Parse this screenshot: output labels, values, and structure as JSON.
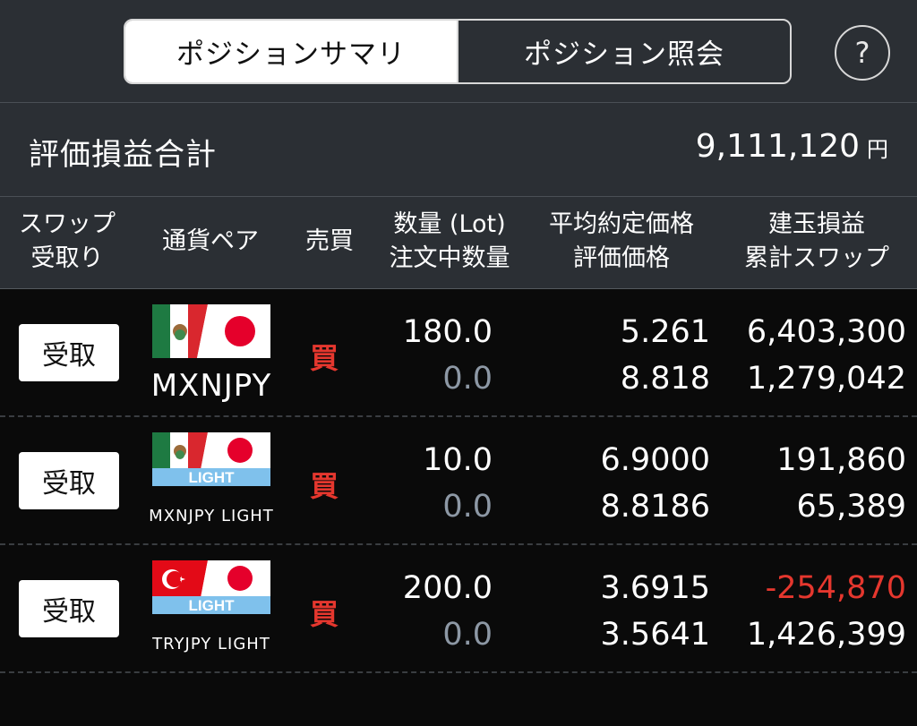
{
  "tabs": {
    "summary": "ポジションサマリ",
    "inquiry": "ポジション照会"
  },
  "help_icon": "?",
  "summary": {
    "label": "評価損益合計",
    "value": "9,111,120",
    "unit": "円"
  },
  "columns": {
    "swap_line1": "スワップ",
    "swap_line2": "受取り",
    "pair": "通貨ペア",
    "side": "売買",
    "qty_line1": "数量 (Lot)",
    "qty_line2": "注文中数量",
    "price_line1": "平均約定価格",
    "price_line2": "評価価格",
    "pl_line1": "建玉損益",
    "pl_line2": "累計スワップ"
  },
  "rows": [
    {
      "button": "受取",
      "flag": "mexico-japan-flag",
      "pair": "MXNJPY",
      "side": "買",
      "qty": "180.0",
      "order_qty": "0.0",
      "avg_price": "5.261",
      "eval_price": "8.818",
      "pl": "6,403,300",
      "swap": "1,279,042"
    },
    {
      "button": "受取",
      "flag": "mexico-japan-light-flag",
      "flag_badge": "LIGHT",
      "pair": "MXNJPY LIGHT",
      "side": "買",
      "qty": "10.0",
      "order_qty": "0.0",
      "avg_price": "6.9000",
      "eval_price": "8.8186",
      "pl": "191,860",
      "swap": "65,389"
    },
    {
      "button": "受取",
      "flag": "turkey-japan-light-flag",
      "flag_badge": "LIGHT",
      "pair": "TRYJPY LIGHT",
      "side": "買",
      "qty": "200.0",
      "order_qty": "0.0",
      "avg_price": "3.6915",
      "eval_price": "3.5641",
      "pl": "-254,870",
      "swap": "1,426,399"
    }
  ],
  "colors": {
    "panel": "#2b2f34",
    "background": "#0a0a0a",
    "negative": "#e5372e",
    "buy": "#e5372e",
    "muted": "#8d98a5",
    "light_band": "#7fc1ec"
  }
}
